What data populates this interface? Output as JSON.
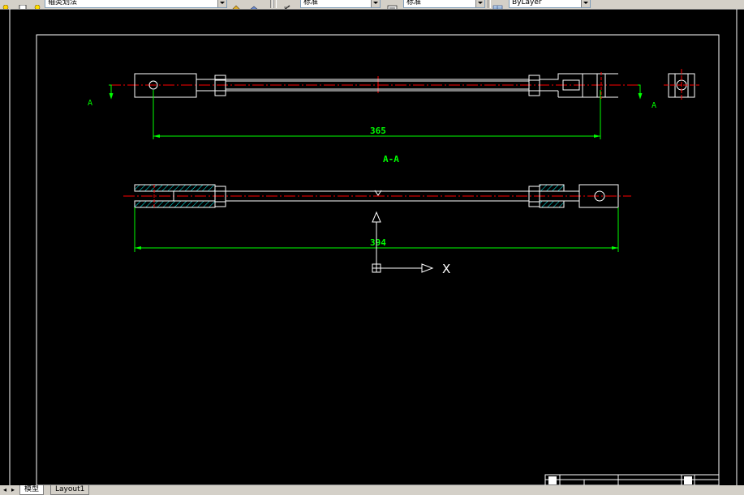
{
  "toolbar": {
    "layer_name": "轴类划法",
    "textstyle_value": "标准",
    "dimstyle_value": "标准",
    "linetype_value": "ByLayer"
  },
  "drawing": {
    "dim_top": "365",
    "section_title": "A-A",
    "dim_bottom": "394",
    "view_marker_left": "A",
    "view_marker_right": "A",
    "ucs_x_label": "X"
  },
  "tabs": {
    "nav_icon": "tab-nav-arrows-icon",
    "model": "模型",
    "layout1": "Layout1"
  },
  "colors": {
    "background": "#000000",
    "outline": "#ffffff",
    "dimension": "#00ff00",
    "centerline": "#ff0000",
    "hatch": "#00ffff"
  }
}
